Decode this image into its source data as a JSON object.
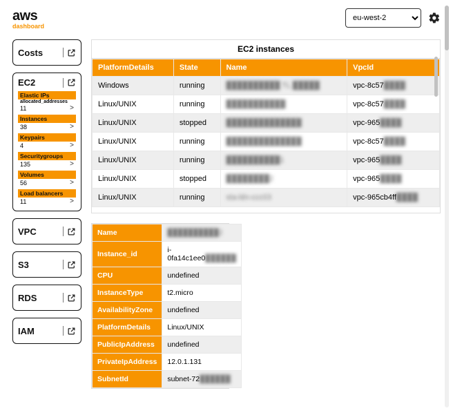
{
  "header": {
    "logo": "aws",
    "subtitle": "dashboard",
    "region": "eu-west-2"
  },
  "sidebar": {
    "costs": "Costs",
    "ec2": {
      "title": "EC2",
      "items": [
        {
          "label": "Elastic IPs",
          "sublabel": "allocated_addresses",
          "value": "11"
        },
        {
          "label": "Instances",
          "value": "38"
        },
        {
          "label": "Keypairs",
          "value": "4"
        },
        {
          "label": "Securitygroups",
          "value": "135"
        },
        {
          "label": "Volumes",
          "value": "56"
        },
        {
          "label": "Load balancers",
          "value": "11"
        }
      ]
    },
    "vpc": "VPC",
    "s3": "S3",
    "rds": "RDS",
    "iam": "IAM"
  },
  "ec2_instances": {
    "title": "EC2 instances",
    "columns": [
      "PlatformDetails",
      "State",
      "Name",
      "VpcId"
    ],
    "rows": [
      {
        "platform": "Windows",
        "state": "running",
        "name": "██████████ TL █████",
        "vpc": "vpc-8c57████"
      },
      {
        "platform": "Linux/UNIX",
        "state": "running",
        "name": "███████████",
        "vpc": "vpc-8c57████"
      },
      {
        "platform": "Linux/UNIX",
        "state": "stopped",
        "name": "██████████████",
        "vpc": "vpc-965████"
      },
      {
        "platform": "Linux/UNIX",
        "state": "running",
        "name": "██████████████",
        "vpc": "vpc-8c57████"
      },
      {
        "platform": "Linux/UNIX",
        "state": "running",
        "name": "██████████1",
        "vpc": "vpc-965████"
      },
      {
        "platform": "Linux/UNIX",
        "state": "stopped",
        "name": "████████2",
        "vpc": "vpc-965████"
      },
      {
        "platform": "Linux/UNIX",
        "state": "running",
        "name": "sta-ldn-ccc03",
        "vpc": "vpc-965cb4ff"
      }
    ]
  },
  "instance_detail": {
    "rows": [
      {
        "key": "Name",
        "value": "██████████2",
        "blur": true
      },
      {
        "key": "Instance_id",
        "value": "i-0fa14c1ee0████",
        "blur": false
      },
      {
        "key": "CPU",
        "value": "undefined",
        "blur": false
      },
      {
        "key": "InstanceType",
        "value": "t2.micro",
        "blur": false
      },
      {
        "key": "AvailabilityZone",
        "value": "undefined",
        "blur": false
      },
      {
        "key": "PlatformDetails",
        "value": "Linux/UNIX",
        "blur": false
      },
      {
        "key": "PublicIpAddress",
        "value": "undefined",
        "blur": false
      },
      {
        "key": "PrivateIpAddress",
        "value": "12.0.1.131",
        "blur": false
      },
      {
        "key": "SubnetId",
        "value": "subnet-72██████",
        "blur": false
      }
    ]
  }
}
